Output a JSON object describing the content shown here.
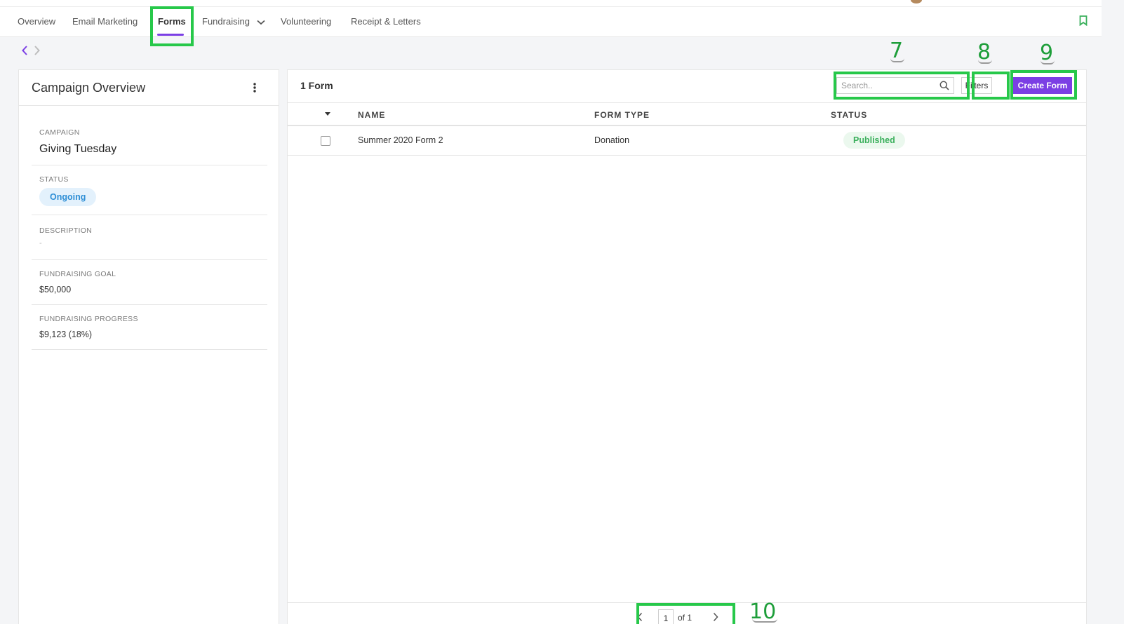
{
  "nav": {
    "items": [
      {
        "label": "Overview"
      },
      {
        "label": "Email Marketing"
      },
      {
        "label": "Forms"
      },
      {
        "label": "Fundraising"
      },
      {
        "label": "Volunteering"
      },
      {
        "label": "Receipt & Letters"
      }
    ],
    "active": "Forms",
    "accent_color": "#7b3fe4",
    "bookmark_icon": "bookmark-icon"
  },
  "campaign_panel": {
    "title": "Campaign Overview",
    "campaign_label": "CAMPAIGN",
    "campaign_value": "Giving Tuesday",
    "status_label": "STATUS",
    "status_value": "Ongoing",
    "description_label": "DESCRIPTION",
    "description_value": "-",
    "goal_label": "FUNDRAISING GOAL",
    "goal_value": "$50,000",
    "progress_label": "FUNDRAISING PROGRESS",
    "progress_value": "$9,123 (18%)"
  },
  "forms": {
    "count_label": "1 Form",
    "search_placeholder": "Search..",
    "filters_label": "Filters",
    "create_label": "Create Form",
    "columns": [
      "NAME",
      "FORM TYPE",
      "STATUS"
    ],
    "rows": [
      {
        "name": "Summer 2020 Form 2",
        "type": "Donation",
        "status": "Published"
      }
    ],
    "pagination": {
      "current": "1",
      "of_text": "of 1"
    }
  },
  "annotations": [
    "7",
    "8",
    "9",
    "10"
  ],
  "colors": {
    "highlight": "#27c84a",
    "primary": "#7b3fe4",
    "published": "#3bb05c",
    "ongoing": "#2f8fd6"
  }
}
